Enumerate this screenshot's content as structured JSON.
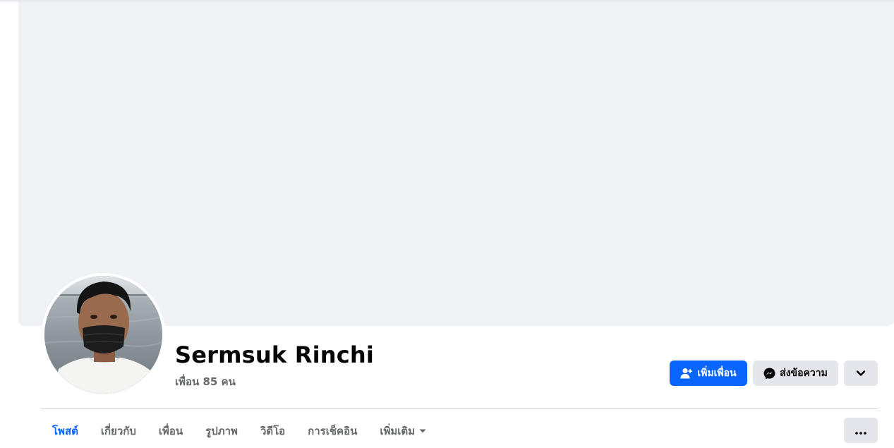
{
  "profile": {
    "name": "Sermsuk Rinchi",
    "friend_count": "เพื่อน 85 คน"
  },
  "actions": {
    "add_friend_label": "เพิ่มเพื่อน",
    "message_label": "ส่งข้อความ",
    "add_friend_icon": "person-add-icon",
    "message_icon": "messenger-icon",
    "more_icon": "chevron-down-icon"
  },
  "tabs": [
    {
      "label": "โพสต์",
      "active": true
    },
    {
      "label": "เกี่ยวกับ",
      "active": false
    },
    {
      "label": "เพื่อน",
      "active": false
    },
    {
      "label": "รูปภาพ",
      "active": false
    },
    {
      "label": "วิดีโอ",
      "active": false
    },
    {
      "label": "การเช็คอิน",
      "active": false
    },
    {
      "label": "เพิ่มเติม",
      "active": false
    }
  ],
  "tab_more_icon": "ellipsis-icon",
  "colors": {
    "accent": "#0866ff",
    "cover": "#f0f2f5",
    "secondary_button": "#e4e6eb",
    "muted_text": "#65676b"
  }
}
